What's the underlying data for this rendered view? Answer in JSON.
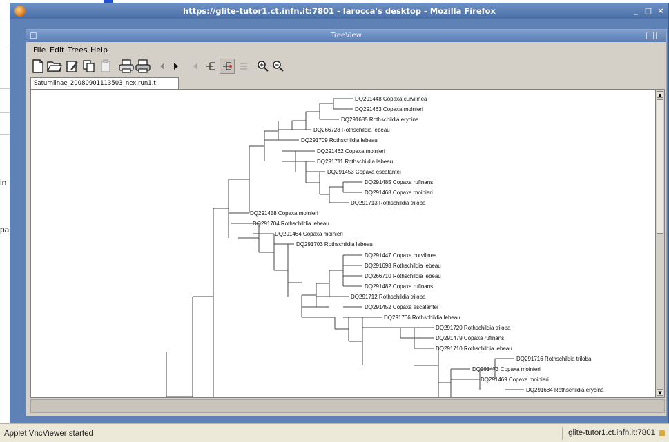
{
  "background_page": {
    "fragments": [
      "in",
      "pa"
    ]
  },
  "firefox": {
    "title": "https://glite-tutor1.ct.infn.it:7801 - larocca's desktop - Mozilla Firefox",
    "minimize": "_",
    "maximize": "□",
    "close": "×"
  },
  "treeview": {
    "title": "TreeView",
    "menu": [
      "File",
      "Edit",
      "Trees",
      "Help"
    ],
    "tab_label": "Saturniinae_20080901113503_nex.run1.t"
  },
  "status": {
    "left": "Applet VncViewer started",
    "right": "glite-tutor1.ct.infn.it:7801"
  },
  "colors": {
    "desktop_blue": "#5f82b6",
    "title_text": "#ffffff",
    "panel_bg": "#ffffff",
    "window_bg": "#d4d0c8"
  },
  "icons": [
    "new-icon",
    "open-icon",
    "edit-icon",
    "copy-icon",
    "paste-icon",
    "print-preview-icon",
    "print-icon",
    "back-icon",
    "forward-icon",
    "previous-icon",
    "collapse-icon",
    "expand-icon",
    "zoom-in-icon",
    "zoom-out-icon"
  ],
  "taxa": [
    "DQ291448 Copaxa curvilinea",
    "DQ291463 Copaxa moinieri",
    "DQ291685 Rothschildia erycina",
    "DQ266728 Rothschildia lebeau",
    "DQ291709 Rothschildia lebeau",
    "DQ291462 Copaxa moinieri",
    "DQ291711 Rothschildia lebeau",
    "DQ291453 Copaxa escalantei",
    "DQ291485 Copaxa rufinans",
    "DQ291468 Copaxa moinieri",
    "DQ291713 Rothschildia triloba",
    "DQ291458 Copaxa moinieri",
    "DQ291704 Rothschildia lebeau",
    "DQ291464 Copaxa moinieri",
    "DQ291703 Rothschildia lebeau",
    "DQ291447 Copaxa curvilinea",
    "DQ291698 Rothschildia lebeau",
    "DQ266710 Rothschildia lebeau",
    "DQ291482 Copaxa rufinans",
    "DQ291712 Rothschildia triloba",
    "DQ291452 Copaxa escalantei",
    "DQ291706 Rothschildia lebeau",
    "DQ291720 Rothschildia triloba",
    "DQ291479 Copaxa rufinans",
    "DQ291710 Rothschildia lebeau",
    "DQ291716 Rothschildia triloba",
    "DQ291473 Copaxa moinieri",
    "DQ291469 Copaxa moinieri",
    "DQ291684 Rothschildia erycina"
  ]
}
